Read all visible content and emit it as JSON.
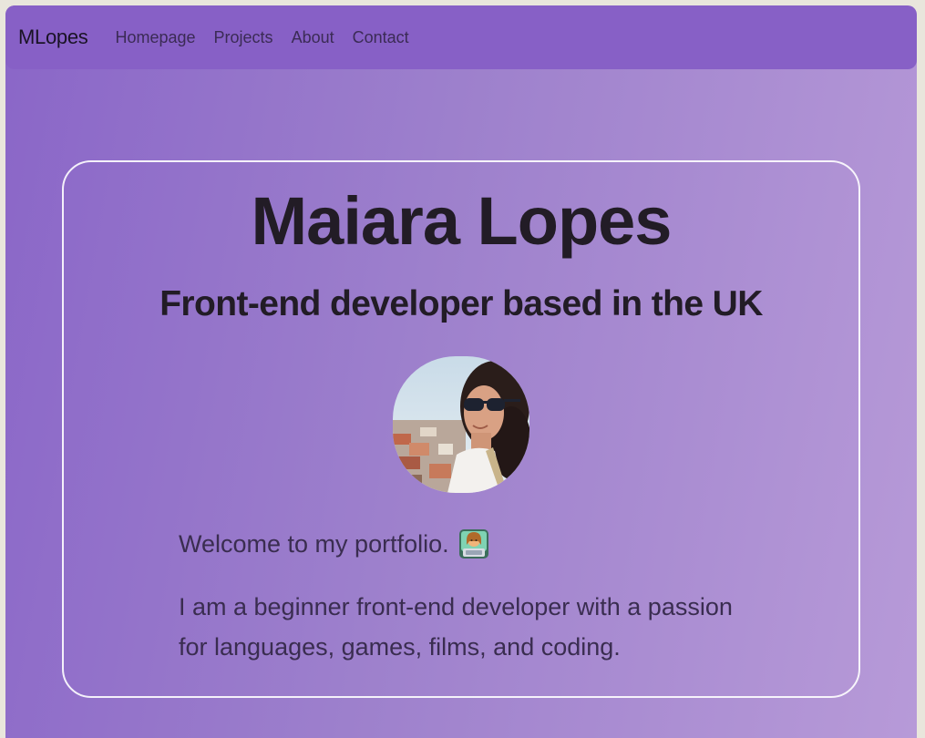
{
  "navbar": {
    "brand": "MLopes",
    "links": [
      "Homepage",
      "Projects",
      "About",
      "Contact"
    ]
  },
  "hero": {
    "name": "Maiara Lopes",
    "subtitle": "Front-end developer based in the UK",
    "avatar_icon": "profile-photo",
    "welcome": "Welcome to my portfolio.",
    "welcome_emoji": "woman-technologist-icon",
    "bio": "I am a beginner front-end developer with a passion for languages, games, films, and coding."
  },
  "colors": {
    "navbar": "#8760c6",
    "gradient_start": "#8a66c8",
    "gradient_end": "#b79ad8",
    "text_dark": "#221c26",
    "text_body": "#3a2d50"
  }
}
